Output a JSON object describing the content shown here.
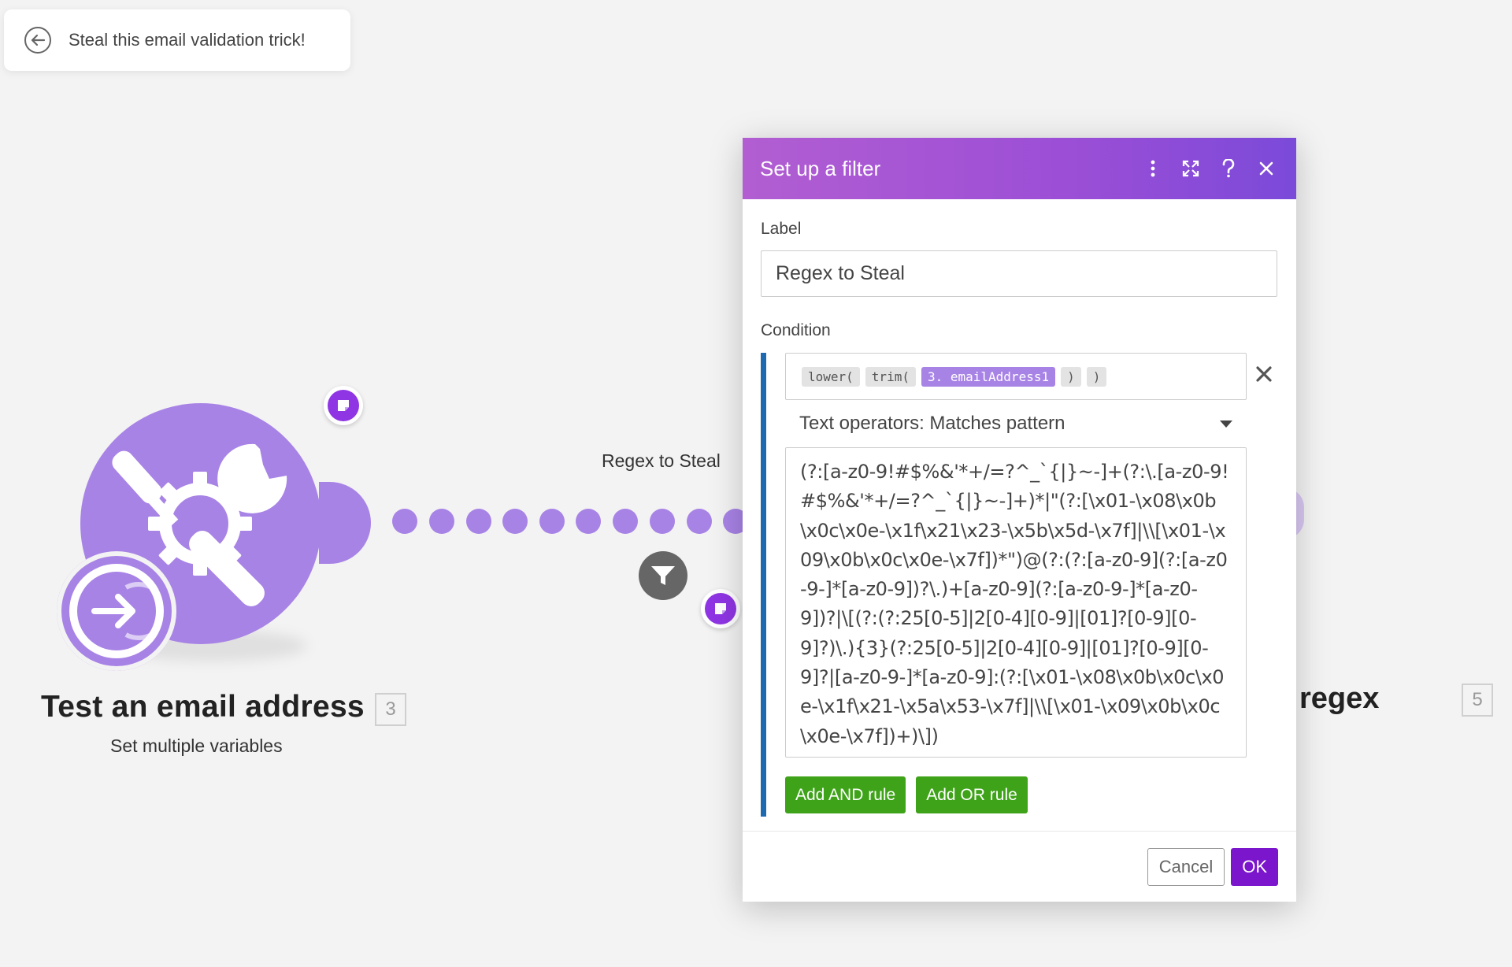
{
  "breadcrumb": {
    "title": "Steal this email validation trick!"
  },
  "canvas": {
    "route_label": "Regex to Steal",
    "left_module": {
      "title": "Test an email address",
      "number": "3",
      "subtitle": "Set multiple variables"
    },
    "right_module": {
      "title": "regex",
      "number": "5"
    }
  },
  "dialog": {
    "title": "Set up a filter",
    "label_field": {
      "label": "Label",
      "value": "Regex to Steal"
    },
    "condition": {
      "label": "Condition",
      "tokens": [
        "lower(",
        "trim(",
        "3. emailAddress1",
        ")",
        ")"
      ],
      "operator": "Text operators: Matches pattern",
      "pattern": "(?:[a-z0-9!#$%&'*+/=?^_`{|}~-]+(?:\\.[a-z0-9!#$%&'*+/=?^_`{|}~-]+)*|\"(?:[\\x01-\\x08\\x0b\\x0c\\x0e-\\x1f\\x21\\x23-\\x5b\\x5d-\\x7f]|\\\\[\\x01-\\x09\\x0b\\x0c\\x0e-\\x7f])*\")@(?:(?:[a-z0-9](?:[a-z0-9-]*[a-z0-9])?\\.)+[a-z0-9](?:[a-z0-9-]*[a-z0-9])?|\\[(?:(?:25[0-5]|2[0-4][0-9]|[01]?[0-9][0-9]?)\\.){3}(?:25[0-5]|2[0-4][0-9]|[01]?[0-9][0-9]?|[a-z0-9-]*[a-z0-9]:(?:[\\x01-\\x08\\x0b\\x0c\\x0e-\\x1f\\x21-\\x5a\\x53-\\x7f]|\\\\[\\x01-\\x09\\x0b\\x0c\\x0e-\\x7f])+)\\])"
    },
    "add_and_rule": "Add AND rule",
    "add_or_rule": "Add OR rule",
    "cancel": "Cancel",
    "ok": "OK"
  },
  "colors": {
    "module": "#a883e6",
    "header_gradient_start": "#b25ed2",
    "header_gradient_end": "#7b4ad9",
    "condition_bar": "#1d6ab1",
    "rule_button": "#3ea318",
    "ok_button": "#7b16cc"
  }
}
